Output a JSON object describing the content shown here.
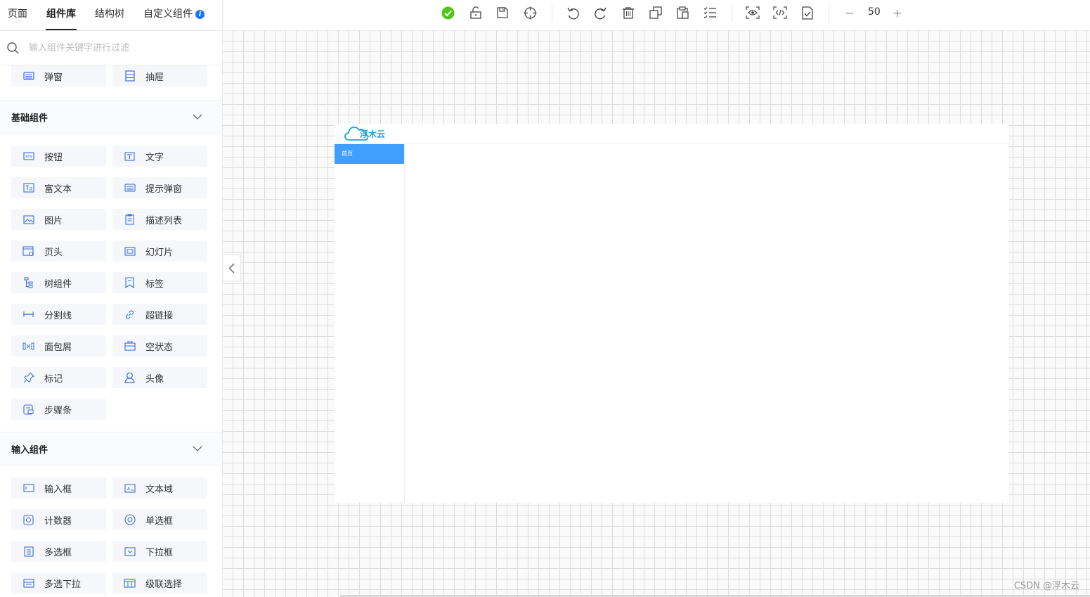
{
  "sidebar": {
    "tabs": [
      {
        "label": "页面"
      },
      {
        "label": "组件库"
      },
      {
        "label": "结构树"
      },
      {
        "label": "自定义组件"
      }
    ],
    "search_placeholder": "输入组件关键字进行过滤",
    "top_items": [
      {
        "label": "弹窗",
        "icon": "dialog-icon"
      },
      {
        "label": "抽屉",
        "icon": "drawer-icon"
      }
    ],
    "groups": [
      {
        "title": "基础组件",
        "items": [
          {
            "label": "按钮"
          },
          {
            "label": "文字"
          },
          {
            "label": "富文本"
          },
          {
            "label": "提示弹窗"
          },
          {
            "label": "图片"
          },
          {
            "label": "描述列表"
          },
          {
            "label": "页头"
          },
          {
            "label": "幻灯片"
          },
          {
            "label": "树组件"
          },
          {
            "label": "标签"
          },
          {
            "label": "分割线"
          },
          {
            "label": "超链接"
          },
          {
            "label": "面包屑"
          },
          {
            "label": "空状态"
          },
          {
            "label": "标记"
          },
          {
            "label": "头像"
          },
          {
            "label": "步骤条"
          }
        ]
      },
      {
        "title": "输入组件",
        "items": [
          {
            "label": "输入框"
          },
          {
            "label": "文本域"
          },
          {
            "label": "计数器"
          },
          {
            "label": "单选框"
          },
          {
            "label": "多选框"
          },
          {
            "label": "下拉框"
          },
          {
            "label": "多选下拉"
          },
          {
            "label": "级联选择"
          }
        ]
      }
    ]
  },
  "toolbar": {
    "zoom_value": "50",
    "zoom_minus": "−",
    "zoom_plus": "+"
  },
  "preview": {
    "logo_text": "浮木云",
    "menu_active": "首页"
  },
  "watermark": "CSDN @浮木云",
  "colors": {
    "accent": "#409eff",
    "icon_blue": "#3b6fd6",
    "success": "#52c41a",
    "logo": "#1aa3d6"
  }
}
